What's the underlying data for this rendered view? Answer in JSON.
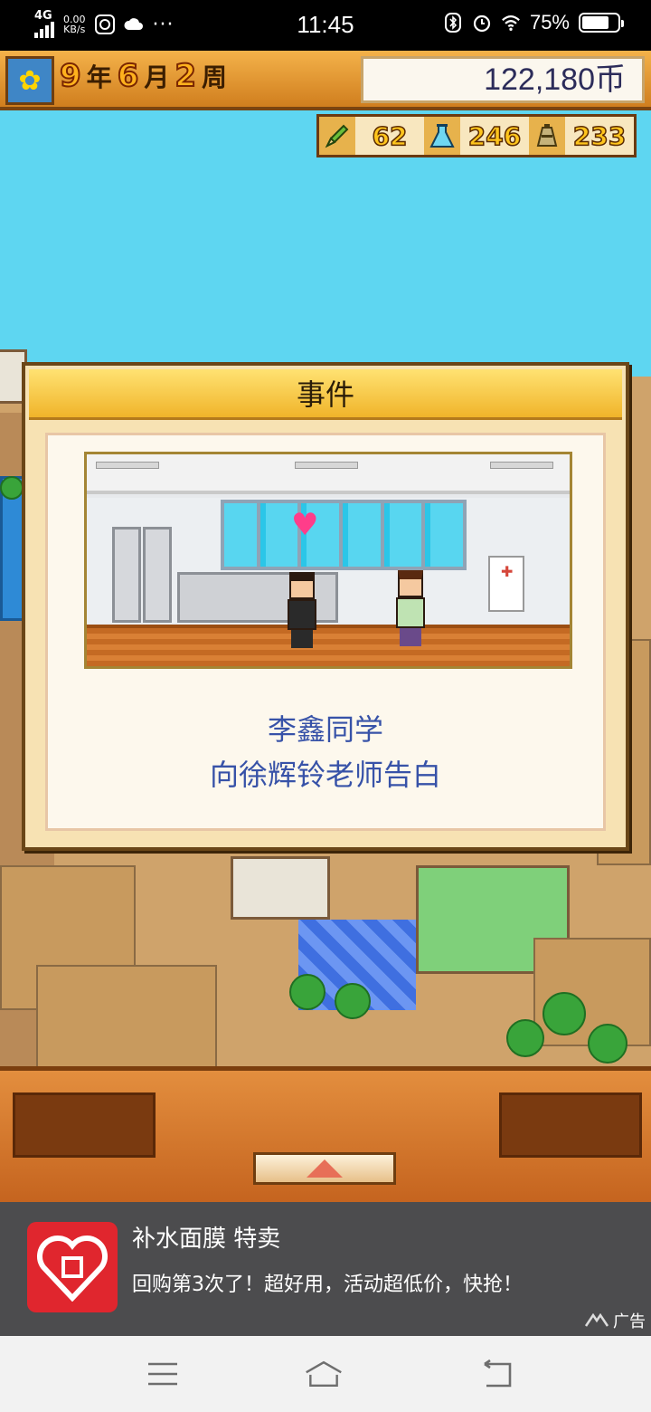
{
  "status_bar": {
    "network": "4G",
    "speed_value": "0.00",
    "speed_unit": "KB/s",
    "more": "···",
    "time": "11:45",
    "battery_text": "75%",
    "battery_level": 0.75
  },
  "hud": {
    "year_num": "9",
    "year_unit": "年",
    "month_num": "6",
    "month_unit": "月",
    "week_num": "2",
    "week_unit": "周",
    "money": "122,180币"
  },
  "resources": [
    {
      "icon": "pencil-icon",
      "value": "62"
    },
    {
      "icon": "flask-icon",
      "value": "246"
    },
    {
      "icon": "weight-icon",
      "value": "233"
    }
  ],
  "dialog": {
    "title": "事件",
    "line1": "李鑫同学",
    "line2": "向徐辉铃老师告白"
  },
  "ad": {
    "title": "补水面膜 特卖",
    "body": "回购第3次了！超好用，活动超低价，快抢！",
    "tag": "广告"
  },
  "colors": {
    "sky": "#5ed6f1",
    "hud_orange": "#f4b24a",
    "dialog_title": "#f0b42a",
    "dialog_text": "#3752a8",
    "heart": "#ff3d8a",
    "ad_brand": "#e0262e"
  }
}
